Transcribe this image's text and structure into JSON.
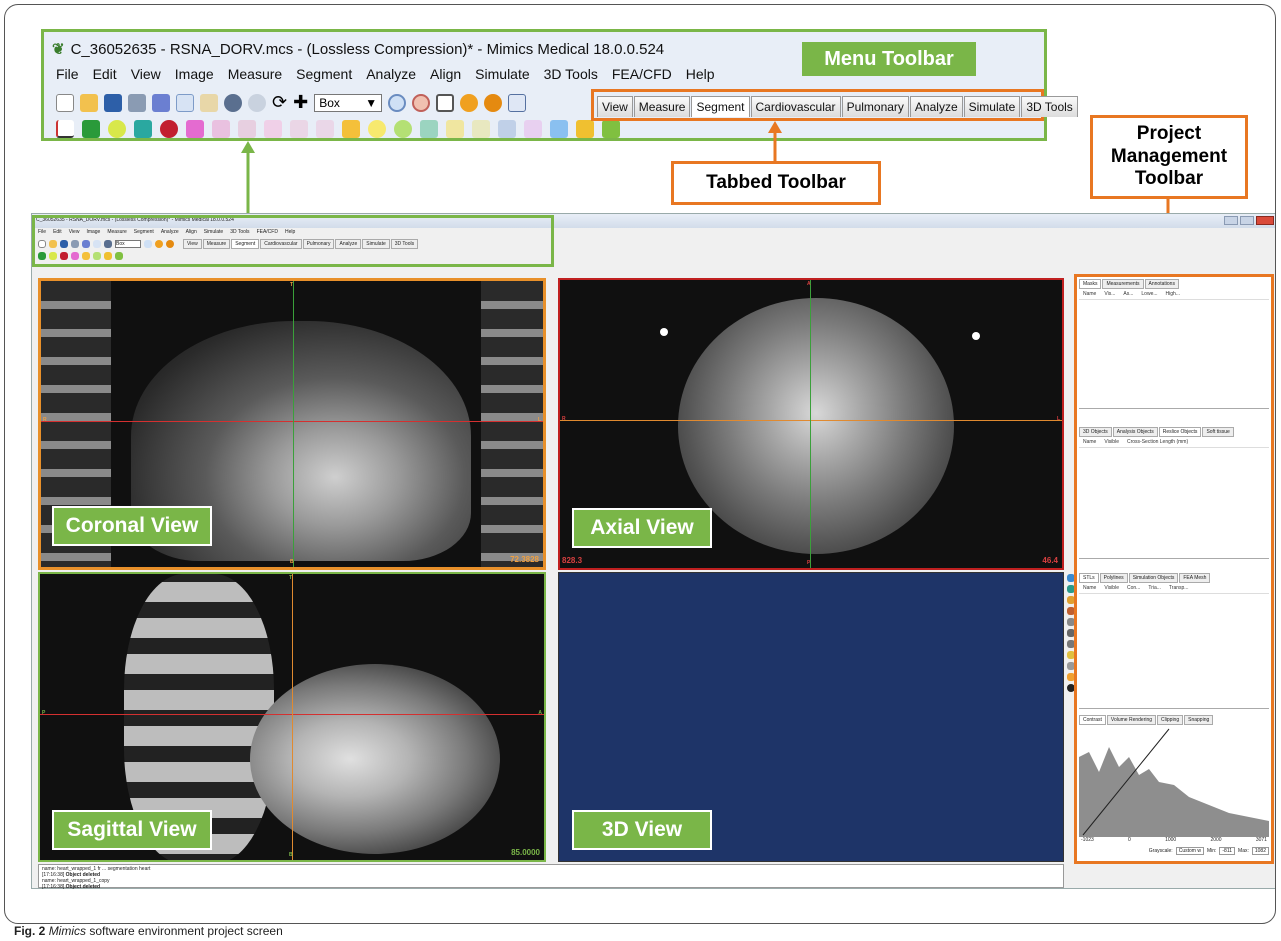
{
  "zoom_callout": {
    "app_title": "C_36052635 - RSNA_DORV.mcs -  (Lossless Compression)* - Mimics Medical 18.0.0.524",
    "menu": [
      "File",
      "Edit",
      "View",
      "Image",
      "Measure",
      "Segment",
      "Analyze",
      "Align",
      "Simulate",
      "3D Tools",
      "FEA/CFD",
      "Help"
    ],
    "box_select": "Box",
    "tabs": [
      "View",
      "Measure",
      "Segment",
      "Cardiovascular",
      "Pulmonary",
      "Analyze",
      "Simulate",
      "3D Tools"
    ],
    "active_tab": "Segment"
  },
  "labels": {
    "menu_toolbar": "Menu Toolbar",
    "tabbed_toolbar": "Tabbed Toolbar",
    "project_mgmt_1": "Project",
    "project_mgmt_2": "Management",
    "project_mgmt_3": "Toolbar"
  },
  "app": {
    "title": "C_36052635 - RSNA_DORV.mcs -  (Lossless Compression)* - Mimics Medical 18.0.0.524",
    "menu": [
      "File",
      "Edit",
      "View",
      "Image",
      "Measure",
      "Segment",
      "Analyze",
      "Align",
      "Simulate",
      "3D Tools",
      "FEA/CFD",
      "Help"
    ],
    "box_select": "Box",
    "tabs": [
      "View",
      "Measure",
      "Segment",
      "Cardiovascular",
      "Pulmonary",
      "Analyze",
      "Simulate",
      "3D Tools"
    ]
  },
  "views": {
    "coronal": {
      "label": "Coronal View",
      "value": "72.3828",
      "top": "T",
      "bottom": "B",
      "left": "R",
      "right": "L"
    },
    "axial": {
      "label": "Axial View",
      "left_value": "828.3",
      "right_value": "46.4",
      "top": "A",
      "bottom": "P",
      "left": "R",
      "right": "L"
    },
    "sagittal": {
      "label": "Sagittal View",
      "value": "85.0000",
      "top": "T",
      "bottom": "B",
      "left": "P",
      "right": "A"
    },
    "threed": {
      "label": "3D View"
    }
  },
  "panel": {
    "masks_tabs": [
      "Masks",
      "Measurements",
      "Annotations"
    ],
    "masks_cols": [
      "Name",
      "Vis...",
      "As...",
      "Lowe...",
      "High..."
    ],
    "objects_tabs": [
      "3D Objects",
      "Analysis Objects",
      "Reslice Objects",
      "Soft tissue"
    ],
    "objects_cols": [
      "Name",
      "Visible",
      "Cross-Section Length (mm)"
    ],
    "stl_tabs": [
      "STLs",
      "Polylines",
      "Simulation Objects",
      "FEA Mesh"
    ],
    "stl_cols": [
      "Name",
      "Visible",
      "Con...",
      "Tria...",
      "Transp..."
    ],
    "contrast_tabs": [
      "Contrast",
      "Volume Rendering",
      "Clipping",
      "Snapping"
    ],
    "axis_ticks": [
      "-1023",
      "0",
      "1000",
      "2000",
      "3071"
    ],
    "grayscale_label": "Grayscale:",
    "grayscale_value": "Custom w",
    "min_label": "Min:",
    "min_value": "-811",
    "max_label": "Max:",
    "max_value": "1082"
  },
  "log": {
    "line0": "name: heart_wrapped_1 fr ... segmentation heart",
    "line1_time": "[17:16:38]",
    "line1_text": "Object deleted",
    "line2": "name: heart_wrapped_1_copy",
    "line3_time": "[17:16:38]",
    "line3_text": "Object deleted"
  },
  "caption": {
    "fig": "Fig. 2",
    "italic": "Mimics",
    "rest": " software environment project screen"
  },
  "colors": {
    "callout_green": "#7ab648",
    "callout_orange": "#e87722",
    "view_3d_bg": "#1e3468"
  }
}
